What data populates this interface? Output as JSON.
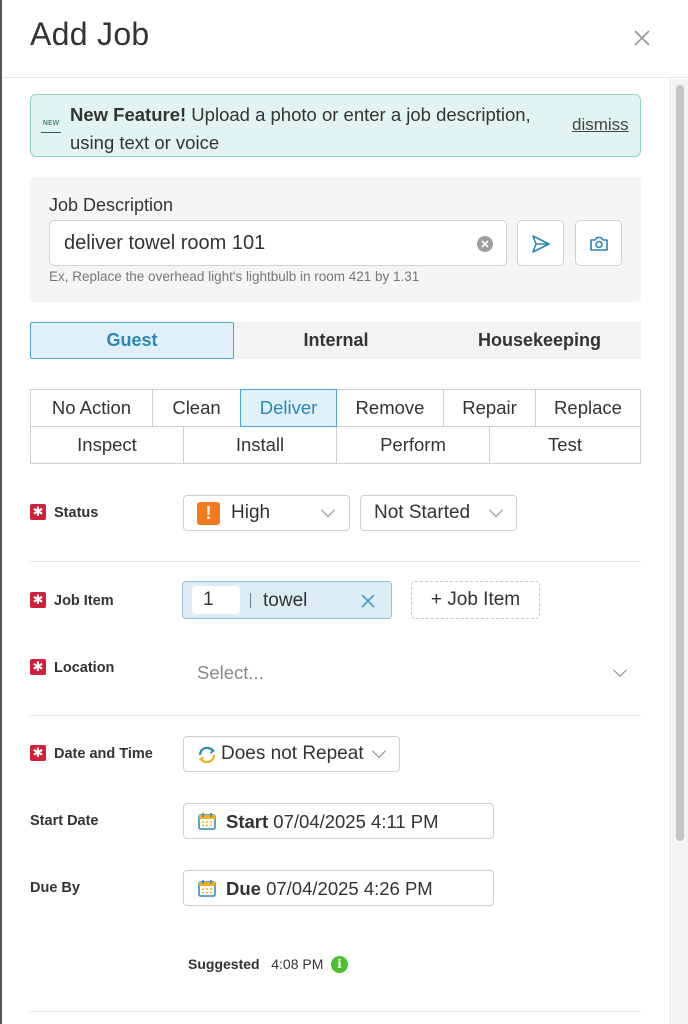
{
  "header": {
    "title": "Add Job"
  },
  "banner": {
    "icon_text": "NEW",
    "title": "New Feature!",
    "text": " Upload a photo or enter a job description, using text or voice",
    "dismiss_label": "dismiss"
  },
  "job_description": {
    "label": "Job Description",
    "value": "deliver towel room 101",
    "hint": "Ex, Replace the overhead light's lightbulb in room 421 by 1.31"
  },
  "tabs": [
    {
      "label": "Guest",
      "active": true
    },
    {
      "label": "Internal",
      "active": false
    },
    {
      "label": "Housekeeping",
      "active": false
    }
  ],
  "actions": {
    "row1": [
      "No Action",
      "Clean",
      "Deliver",
      "Remove",
      "Repair",
      "Replace"
    ],
    "row2": [
      "Inspect",
      "Install",
      "Perform",
      "Test"
    ],
    "selected": "Deliver"
  },
  "status": {
    "label": "Status",
    "priority": "High",
    "state": "Not Started",
    "priority_color": "#f47a20"
  },
  "job_item": {
    "label": "Job Item",
    "quantity": "1",
    "name": "towel",
    "add_label": "+ Job Item"
  },
  "location": {
    "label": "Location",
    "placeholder": "Select..."
  },
  "date_time": {
    "label": "Date and Time",
    "repeat": "Does not Repeat"
  },
  "start_date": {
    "label": "Start Date",
    "prefix": "Start",
    "value": "07/04/2025 4:11 PM"
  },
  "due_by": {
    "label": "Due By",
    "prefix": "Due",
    "value": "07/04/2025 4:26 PM"
  },
  "suggested": {
    "label": "Suggested",
    "value": "4:08 PM"
  },
  "colors": {
    "accent": "#2b87b5",
    "required": "#d0213b",
    "banner_bg": "#e2f4f1",
    "info": "#4bbf2d"
  }
}
